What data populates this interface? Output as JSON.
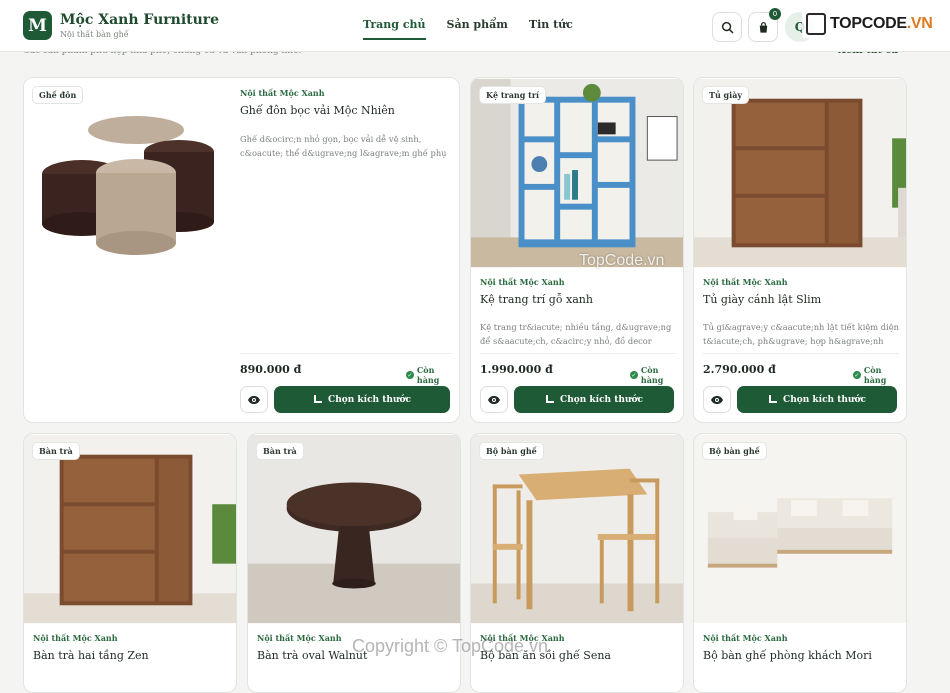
{
  "brand": {
    "logo_letter": "M",
    "name": "Mộc Xanh Furniture",
    "tagline": "Nội thất bàn ghế"
  },
  "nav": [
    {
      "label": "Trang chủ",
      "active": true
    },
    {
      "label": "Sản phẩm",
      "active": false
    },
    {
      "label": "Tin tức",
      "active": false
    }
  ],
  "header": {
    "cart_count": "0",
    "avatar_initial": "Q"
  },
  "watermark": {
    "logo_text": "TOPCODE",
    "logo_suffix": ".VN",
    "image_mark": "TopCode.vn",
    "footer_mark": "Copyright © TopCode.vn"
  },
  "section": {
    "subtitle": "Các sản phẩm phù hợp nhà phố, chung cư và văn phòng nhỏ.",
    "view_all": "Xem tất cả"
  },
  "accent_color": "#1f5a37",
  "products": [
    {
      "category": "Ghế đôn",
      "brand": "Nội thất Mộc Xanh",
      "name": "Ghế đôn bọc vải Mộc Nhiên",
      "description": "Ghế d&ocirc;n nhỏ gọn, bọc vải dễ vệ sinh, c&oacute; thể d&ugrave;ng l&agrave;m ghế phụ hoặc k&ecirc;...",
      "price": "890.000 đ",
      "stock": "Còn hàng",
      "button": "Chọn kích thước"
    },
    {
      "category": "Kệ trang trí",
      "brand": "Nội thất Mộc Xanh",
      "name": "Kệ trang trí gỗ xanh",
      "description": "Kệ trang tr&iacute; nhiều tầng, d&ugrave;ng để s&aacute;ch, c&acirc;y nhỏ, đồ decor v&agrave; v...",
      "price": "1.990.000 đ",
      "stock": "Còn hàng",
      "button": "Chọn kích thước"
    },
    {
      "category": "Tủ giày",
      "brand": "Nội thất Mộc Xanh",
      "name": "Tủ giày cánh lật Slim",
      "description": "Tủ gi&agrave;y c&aacute;nh lật tiết kiệm diện t&iacute;ch, ph&ugrave; hợp h&agrave;nh lang,...",
      "price": "2.790.000 đ",
      "stock": "Còn hàng",
      "button": "Chọn kích thước"
    },
    {
      "category": "Bàn trà",
      "brand": "Nội thất Mộc Xanh",
      "name": "Bàn trà hai tầng Zen"
    },
    {
      "category": "Bàn trà",
      "brand": "Nội thất Mộc Xanh",
      "name": "Bàn trà oval Walnut"
    },
    {
      "category": "Bộ bàn ghế",
      "brand": "Nội thất Mộc Xanh",
      "name": "Bộ bàn ăn sồi ghế Sena"
    },
    {
      "category": "Bộ bàn ghế",
      "brand": "Nội thất Mộc Xanh",
      "name": "Bộ bàn ghế phòng khách Mori"
    }
  ]
}
